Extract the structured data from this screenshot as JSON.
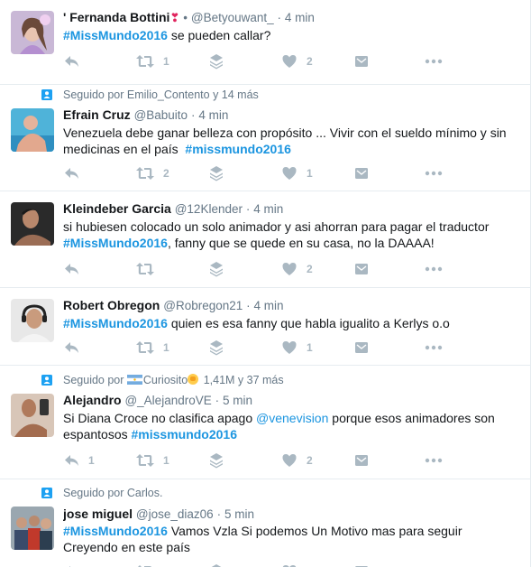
{
  "tweets": [
    {
      "context": null,
      "name": "' Fernanda Bottini",
      "name_suffix": "•",
      "username": "@Betyouwant_",
      "sep": "·",
      "time": "4 min",
      "text_html": "<span class=\"hashtag\" data-name=\"hashtag-link\" data-interactable=\"true\">#MissMundo2016</span> se pueden callar?",
      "reply_count": "",
      "retweet_count": "1",
      "like_count": "2",
      "avatar": "avatar-girl-pink"
    },
    {
      "context": "Seguido por Emilio_Contento y 14 más",
      "name": "Efrain Cruz",
      "name_suffix": "",
      "username": "@Babuito",
      "sep": "·",
      "time": "4 min",
      "text_html": "Venezuela debe ganar belleza con propósito ... Vivir con el sueldo mínimo y sin medicinas en el país &nbsp;<span class=\"hashtag\" data-name=\"hashtag-link\" data-interactable=\"true\">#missmundo2016</span>",
      "reply_count": "",
      "retweet_count": "2",
      "like_count": "1",
      "avatar": "avatar-man-pool"
    },
    {
      "context": null,
      "name": "Kleindeber Garcia",
      "name_suffix": "",
      "username": "@12Klender",
      "sep": "·",
      "time": "4 min",
      "text_html": "si hubiesen colocado un solo animador y asi ahorran para pagar el traductor <span class=\"hashtag\" data-name=\"hashtag-link\" data-interactable=\"true\">#MissMundo2016</span>, fanny que se quede en su casa, no la DAAAA!",
      "reply_count": "",
      "retweet_count": "",
      "like_count": "2",
      "avatar": "avatar-man-dark"
    },
    {
      "context": null,
      "name": "Robert Obregon",
      "name_suffix": "",
      "username": "@Robregon21",
      "sep": "·",
      "time": "4 min",
      "text_html": "<span class=\"hashtag\" data-name=\"hashtag-link\" data-interactable=\"true\">#MissMundo2016</span> quien es esa fanny que habla igualito a Kerlys o.o",
      "reply_count": "",
      "retweet_count": "1",
      "like_count": "1",
      "avatar": "avatar-man-headphones"
    },
    {
      "context": "Seguido por",
      "context_name": "Curiosito",
      "context_more": " 1,41M y 37 más",
      "name": "Alejandro",
      "name_suffix": "",
      "username": "@_AlejandroVE",
      "sep": "·",
      "time": "5 min",
      "text_html": "Si Diana Croce no clasifica apago <span class=\"mention\" data-name=\"mention-link\" data-interactable=\"true\">@venevision</span> porque esos animadores son espantosos <span class=\"hashtag\" data-name=\"hashtag-link\" data-interactable=\"true\">#missmundo2016</span>",
      "reply_count": "1",
      "retweet_count": "1",
      "like_count": "2",
      "avatar": "avatar-man-mirror"
    },
    {
      "context": "Seguido por Carlos.",
      "name": "jose miguel",
      "name_suffix": "",
      "username": "@jose_diaz06",
      "sep": "·",
      "time": "5 min",
      "text_html": "<span class=\"hashtag\" data-name=\"hashtag-link\" data-interactable=\"true\">#MissMundo2016</span> Vamos Vzla Si podemos Un Motivo mas para seguir Creyendo en este país",
      "reply_count": "",
      "retweet_count": "",
      "like_count": "",
      "avatar": "avatar-group"
    }
  ],
  "colors": {
    "link": "#1b95e0",
    "muted": "#657786",
    "icon": "#aab8c2",
    "border": "#e6ecf0",
    "context_icon": "#1da1f2",
    "name_heart": "#e0245e"
  },
  "icons": [
    "reply-icon",
    "retweet-icon",
    "stack-icon",
    "heart-icon",
    "dm-icon",
    "more-icon",
    "follow-context-icon"
  ]
}
